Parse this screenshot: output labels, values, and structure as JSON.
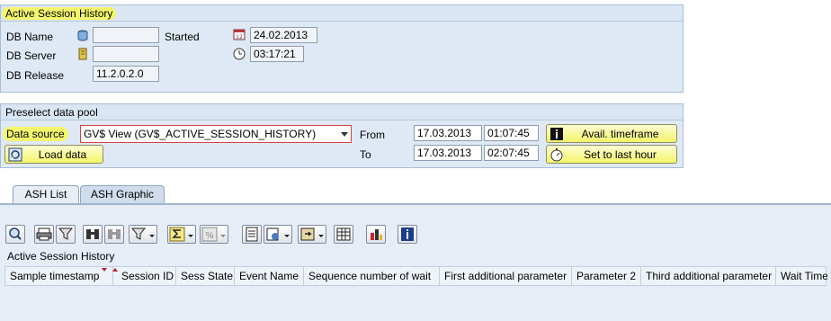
{
  "session_panel": {
    "title": "Active Session History",
    "db_name_label": "DB Name",
    "db_server_label": "DB Server",
    "db_release_label": "DB Release",
    "db_name_value": "",
    "db_server_value": "",
    "db_release_value": "11.2.0.2.0",
    "started_label": "Started",
    "started_date": "24.02.2013",
    "started_time": "03:17:21"
  },
  "preselect_panel": {
    "title": "Preselect data pool",
    "data_source_label": "Data source",
    "data_source_value": "GV$ View (GV$_ACTIVE_SESSION_HISTORY)",
    "load_data_label": "Load data",
    "from_label": "From",
    "to_label": "To",
    "from_date": "17.03.2013",
    "from_time": "01:07:45",
    "to_date": "17.03.2013",
    "to_time": "02:07:45",
    "avail_timeframe_label": "Avail. timeframe",
    "last_hour_label": "Set to last hour"
  },
  "tabs": [
    {
      "label": "ASH List"
    },
    {
      "label": "ASH Graphic"
    }
  ],
  "list": {
    "title": "Active Session History",
    "columns": [
      "Sample timestamp",
      "Session ID",
      "Sess State",
      "Event Name",
      "Sequence number of wait",
      "First additional parameter",
      "Parameter 2",
      "Third additional parameter",
      "Wait Time"
    ]
  },
  "colors": {
    "highlight": "#f4f76c",
    "panel_bg": "#dfe9f5",
    "button_yellow": "#f5f56a"
  }
}
